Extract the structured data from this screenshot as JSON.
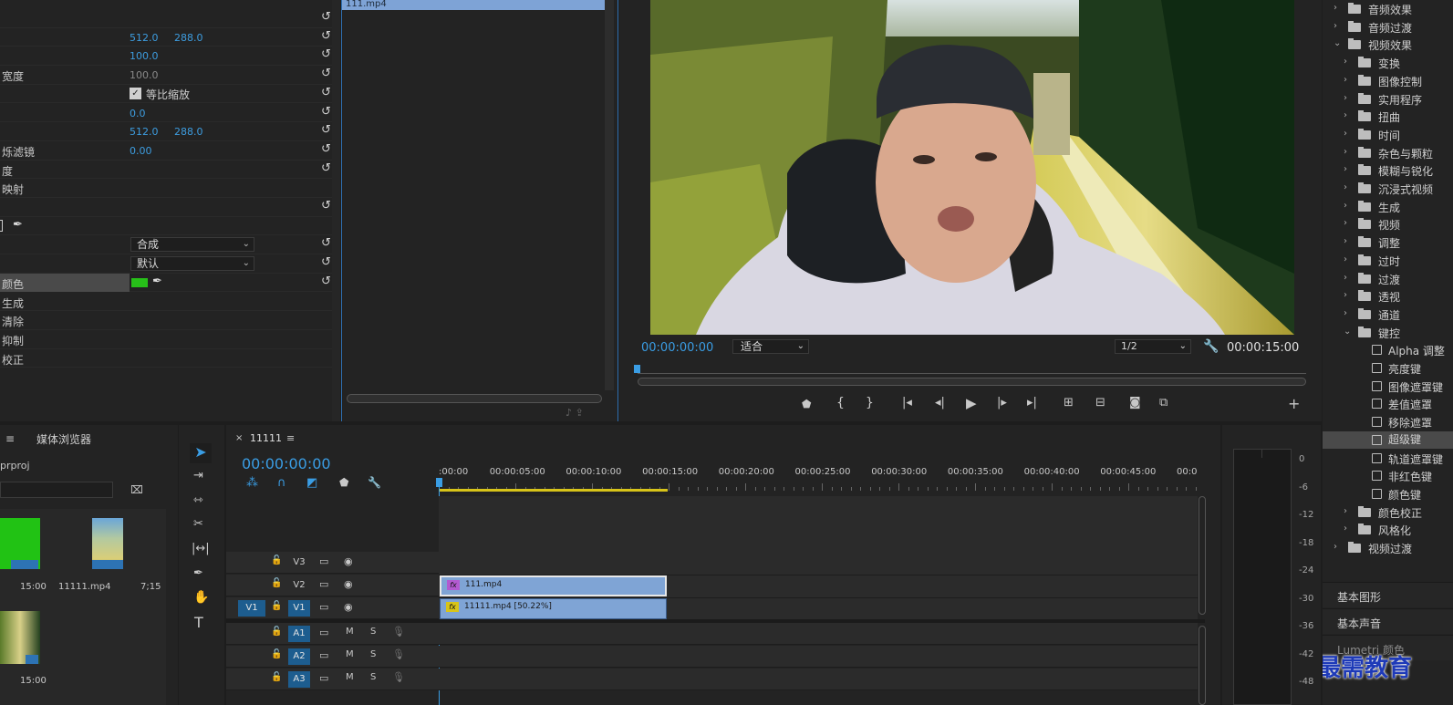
{
  "effect_controls": {
    "rows": [
      {
        "label": "",
        "v1": "",
        "v2": ""
      },
      {
        "label": "",
        "v1": "512.0",
        "v2": "288.0"
      },
      {
        "label": "",
        "v1": "100.0",
        "v2": ""
      },
      {
        "label": "宽度",
        "v1": "100.0",
        "v2": "",
        "grey": true
      },
      {
        "label": "",
        "check": "等比缩放"
      },
      {
        "label": "",
        "v1": "0.0",
        "v2": ""
      },
      {
        "label": "",
        "v1": "512.0",
        "v2": "288.0"
      },
      {
        "label": "烁滤镜",
        "v1": "0.00",
        "v2": ""
      },
      {
        "label": "度"
      },
      {
        "label": "映射"
      },
      {
        "label": ""
      },
      {
        "label": ""
      },
      {
        "label": "",
        "select": "合成"
      },
      {
        "label": "",
        "select": "默认"
      },
      {
        "label": "颜色",
        "color": "#27c019"
      },
      {
        "label": "生成"
      },
      {
        "label": "清除"
      },
      {
        "label": "抑制"
      },
      {
        "label": "校正"
      }
    ]
  },
  "source": {
    "clip_name": "111.mp4"
  },
  "program": {
    "timecode_in": "00:00:00:00",
    "fit": "适合",
    "resolution": "1/2",
    "timecode_out": "00:00:15:00"
  },
  "effects_panel": {
    "items": [
      {
        "label": "音频效果",
        "level": 0,
        "type": "folder",
        "open": false
      },
      {
        "label": "音频过渡",
        "level": 0,
        "type": "folder",
        "open": false
      },
      {
        "label": "视频效果",
        "level": 0,
        "type": "folder",
        "open": true
      },
      {
        "label": "变换",
        "level": 1,
        "type": "folder"
      },
      {
        "label": "图像控制",
        "level": 1,
        "type": "folder"
      },
      {
        "label": "实用程序",
        "level": 1,
        "type": "folder"
      },
      {
        "label": "扭曲",
        "level": 1,
        "type": "folder"
      },
      {
        "label": "时间",
        "level": 1,
        "type": "folder"
      },
      {
        "label": "杂色与颗粒",
        "level": 1,
        "type": "folder"
      },
      {
        "label": "模糊与锐化",
        "level": 1,
        "type": "folder"
      },
      {
        "label": "沉浸式视频",
        "level": 1,
        "type": "folder"
      },
      {
        "label": "生成",
        "level": 1,
        "type": "folder"
      },
      {
        "label": "视频",
        "level": 1,
        "type": "folder"
      },
      {
        "label": "调整",
        "level": 1,
        "type": "folder"
      },
      {
        "label": "过时",
        "level": 1,
        "type": "folder"
      },
      {
        "label": "过渡",
        "level": 1,
        "type": "folder"
      },
      {
        "label": "透视",
        "level": 1,
        "type": "folder"
      },
      {
        "label": "通道",
        "level": 1,
        "type": "folder"
      },
      {
        "label": "键控",
        "level": 1,
        "type": "folder",
        "open": true
      },
      {
        "label": "Alpha 调整",
        "level": 2,
        "type": "fx"
      },
      {
        "label": "亮度键",
        "level": 2,
        "type": "fx"
      },
      {
        "label": "图像遮罩键",
        "level": 2,
        "type": "fx"
      },
      {
        "label": "差值遮罩",
        "level": 2,
        "type": "fx"
      },
      {
        "label": "移除遮罩",
        "level": 2,
        "type": "fx"
      },
      {
        "label": "超级键",
        "level": 2,
        "type": "fx",
        "selected": true
      },
      {
        "label": "轨道遮罩键",
        "level": 2,
        "type": "fx"
      },
      {
        "label": "非红色键",
        "level": 2,
        "type": "fx"
      },
      {
        "label": "颜色键",
        "level": 2,
        "type": "fx"
      },
      {
        "label": "颜色校正",
        "level": 1,
        "type": "folder"
      },
      {
        "label": "风格化",
        "level": 1,
        "type": "folder"
      },
      {
        "label": "视频过渡",
        "level": 0,
        "type": "folder"
      }
    ],
    "sections": [
      "基本图形",
      "基本声音",
      "Lumetri 颜色"
    ]
  },
  "project": {
    "tab": "媒体浏览器",
    "path": "prproj",
    "items": [
      {
        "name": "",
        "dur": "15:00"
      },
      {
        "name": "11111.mp4",
        "dur": "7;15"
      },
      {
        "name": "",
        "dur": "15:00"
      }
    ]
  },
  "timeline": {
    "seq_name": "11111",
    "timecode": "00:00:00:00",
    "ruler": [
      ":00:00",
      "00:00:05:00",
      "00:00:10:00",
      "00:00:15:00",
      "00:00:20:00",
      "00:00:25:00",
      "00:00:30:00",
      "00:00:35:00",
      "00:00:40:00",
      "00:00:45:00",
      "00:0"
    ],
    "video_tracks": [
      "V3",
      "V2",
      "V1"
    ],
    "audio_tracks": [
      "A1",
      "A2",
      "A3"
    ],
    "source_patch": "V1",
    "clips": [
      {
        "track": "V2",
        "name": "111.mp4"
      },
      {
        "track": "V1",
        "name": "11111.mp4 [50.22%]"
      }
    ],
    "m": "M",
    "s": "S"
  },
  "meter": {
    "ticks": [
      "0",
      "-6",
      "-12",
      "-18",
      "-24",
      "-30",
      "-36",
      "-42",
      "-48"
    ]
  },
  "watermark": "最需教育"
}
